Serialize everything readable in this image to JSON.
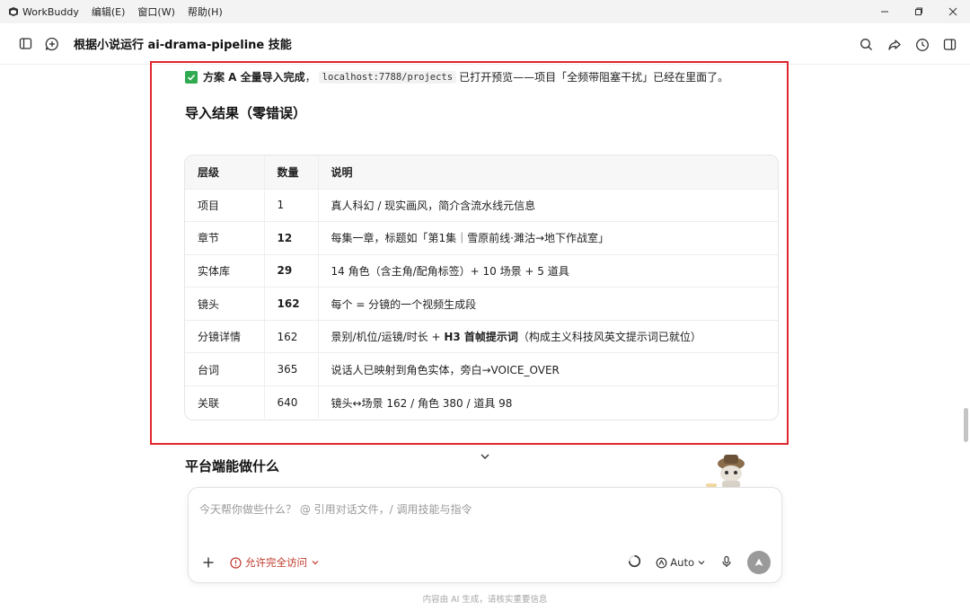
{
  "app": {
    "name": "WorkBuddy",
    "menus": [
      "编辑(E)",
      "窗口(W)",
      "帮助(H)"
    ]
  },
  "header": {
    "title": "根据小说运行 ai-drama-pipeline 技能"
  },
  "content": {
    "status": {
      "strong": "方案 A 全量导入完成",
      "comma": "，",
      "code": "localhost:7788/projects",
      "rest": "已打开预览——项目「全频带阻塞干扰」已经在里面了。"
    },
    "section_title": "导入结果（零错误）",
    "table": {
      "headers": [
        "层级",
        "数量",
        "说明"
      ],
      "rows": [
        {
          "level": "项目",
          "count": "1",
          "desc": "真人科幻 / 现实画风，简介含流水线元信息"
        },
        {
          "level": "章节",
          "count": "12",
          "desc": "每集一章，标题如「第1集｜雪原前线·濉沽→地下作战室」"
        },
        {
          "level": "实体库",
          "count": "29",
          "desc": "14 角色（含主角/配角标签）+ 10 场景 + 5 道具"
        },
        {
          "level": "镜头",
          "count": "162",
          "desc": "每个 = 分镜的一个视频生成段"
        },
        {
          "level": "分镜详情",
          "count": "162",
          "desc_a": "景别/机位/运镜/时长 + ",
          "desc_b": "H3 首帧提示词",
          "desc_c": "（构成主义科技风英文提示词已就位）"
        },
        {
          "level": "台词",
          "count": "365",
          "desc": "说话人已映射到角色实体，旁白→VOICE_OVER"
        },
        {
          "level": "关联",
          "count": "640",
          "desc": "镜头↔场景 162 / 角色 380 / 道具 98"
        }
      ]
    },
    "section_title2": "平台端能做什么"
  },
  "composer": {
    "placeholder": "今天帮你做些什么？ @ 引用对话文件，/ 调用技能与指令",
    "access_label": "允许完全访问",
    "model_label": "Auto"
  },
  "footer": {
    "note": "内容由 AI 生成，请核实重要信息"
  },
  "colors": {
    "accent_red": "#e0262f",
    "access_red": "#c0392b",
    "check_green": "#2faa4f"
  }
}
